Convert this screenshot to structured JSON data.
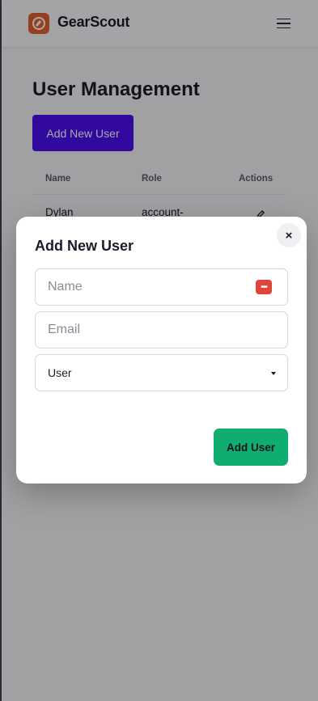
{
  "header": {
    "brand": "GearScout",
    "logo_icon": "compass-icon",
    "menu_icon": "hamburger-menu-icon",
    "brand_color": "#e3602f"
  },
  "main": {
    "title": "User Management",
    "add_button_label": "Add New User",
    "accent_color": "#4b0ff0",
    "table": {
      "columns": [
        "Name",
        "Role",
        "Actions"
      ],
      "rows": [
        {
          "name": "Dylan",
          "role": "account-",
          "action_icon": "edit-pencil-icon"
        }
      ]
    }
  },
  "modal": {
    "title": "Add New User",
    "close_label": "×",
    "name_placeholder": "Name",
    "email_placeholder": "Email",
    "role_selected": "User",
    "submit_label": "Add User",
    "submit_color": "#0fad70",
    "password_manager_icon": "password-manager-icon"
  }
}
